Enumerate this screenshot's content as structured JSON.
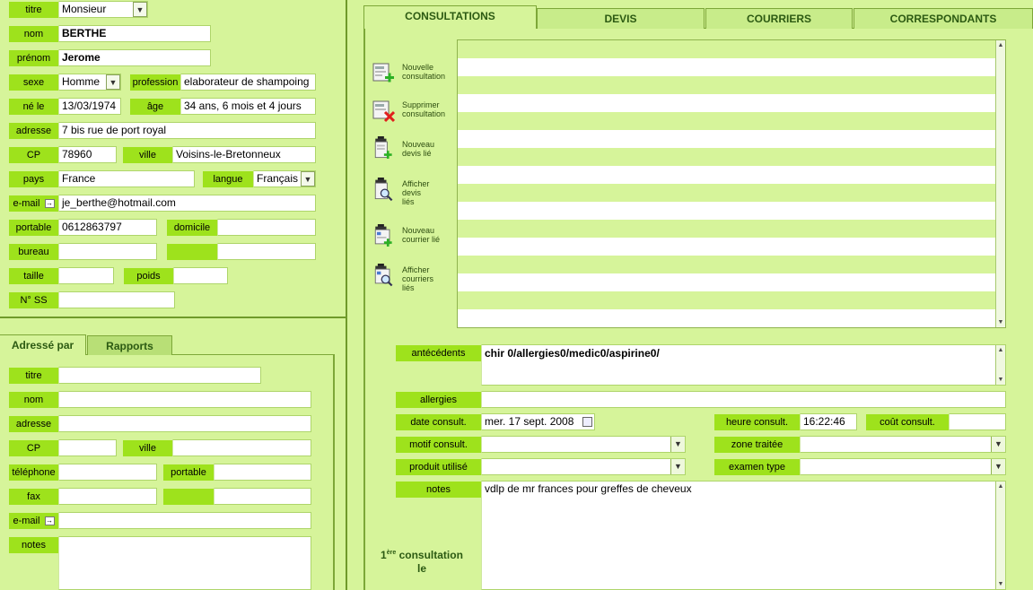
{
  "patient": {
    "titre": {
      "label": "titre",
      "value": "Monsieur"
    },
    "nom": {
      "label": "nom",
      "value": "BERTHE"
    },
    "prenom": {
      "label": "prénom",
      "value": "Jerome"
    },
    "sexe": {
      "label": "sexe",
      "value": "Homme"
    },
    "profession": {
      "label": "profession",
      "value": "elaborateur de shampoing"
    },
    "ne_le": {
      "label": "né le",
      "value": "13/03/1974"
    },
    "age": {
      "label": "âge",
      "value": "34 ans, 6 mois et 4 jours"
    },
    "adresse": {
      "label": "adresse",
      "value": "7 bis rue de port royal"
    },
    "cp": {
      "label": "CP",
      "value": "78960"
    },
    "ville": {
      "label": "ville",
      "value": "Voisins-le-Bretonneux"
    },
    "pays": {
      "label": "pays",
      "value": "France"
    },
    "langue": {
      "label": "langue",
      "value": "Français"
    },
    "email": {
      "label": "e-mail",
      "value": "je_berthe@hotmail.com"
    },
    "portable": {
      "label": "portable",
      "value": "0612863797"
    },
    "domicile": {
      "label": "domicile",
      "value": ""
    },
    "bureau": {
      "label": "bureau",
      "value": ""
    },
    "taille": {
      "label": "taille",
      "value": ""
    },
    "poids": {
      "label": "poids",
      "value": ""
    },
    "nss": {
      "label": "N° SS",
      "value": ""
    }
  },
  "lower_tabs": [
    "Adressé par",
    "Rapports"
  ],
  "adresse_par": {
    "titre": "titre",
    "nom": "nom",
    "adresse": "adresse",
    "cp": "CP",
    "ville": "ville",
    "telephone": "téléphone",
    "portable": "portable",
    "fax": "fax",
    "email": "e-mail",
    "notes": "notes"
  },
  "tabs": [
    "CONSULTATIONS",
    "DEVIS",
    "COURRIERS",
    "CORRESPONDANTS"
  ],
  "actions": [
    {
      "label1": "Nouvelle",
      "label2": "consultation",
      "label3": ""
    },
    {
      "label1": "Supprimer",
      "label2": "consultation",
      "label3": ""
    },
    {
      "label1": "Nouveau",
      "label2": "devis lié",
      "label3": ""
    },
    {
      "label1": "Afficher",
      "label2": "devis",
      "label3": "liés"
    },
    {
      "label1": "Nouveau",
      "label2": "courrier lié",
      "label3": ""
    },
    {
      "label1": "Afficher",
      "label2": "courriers",
      "label3": "liés"
    }
  ],
  "consult": {
    "antecedents_label": "antécédents",
    "antecedents": "chir 0/allergies0/medic0/aspirine0/",
    "allergies_label": "allergies",
    "allergies": "",
    "date_label": "date consult.",
    "date": "mer. 17 sept. 2008",
    "heure_label": "heure consult.",
    "heure": "16:22:46",
    "cout_label": "coût consult.",
    "cout": "",
    "motif_label": "motif consult.",
    "zone_label": "zone traitée",
    "produit_label": "produit utilisé",
    "examen_label": "examen type",
    "notes_label": "notes",
    "notes": "vdlp de mr frances pour greffes de cheveux",
    "premiere_1": "1",
    "premiere_sup": "ère",
    "premiere_2": "consultation",
    "premiere_3": "le"
  },
  "colors": {
    "bg": "#d6f49a",
    "label": "#9ee21c",
    "divider": "#6f9a2a"
  }
}
